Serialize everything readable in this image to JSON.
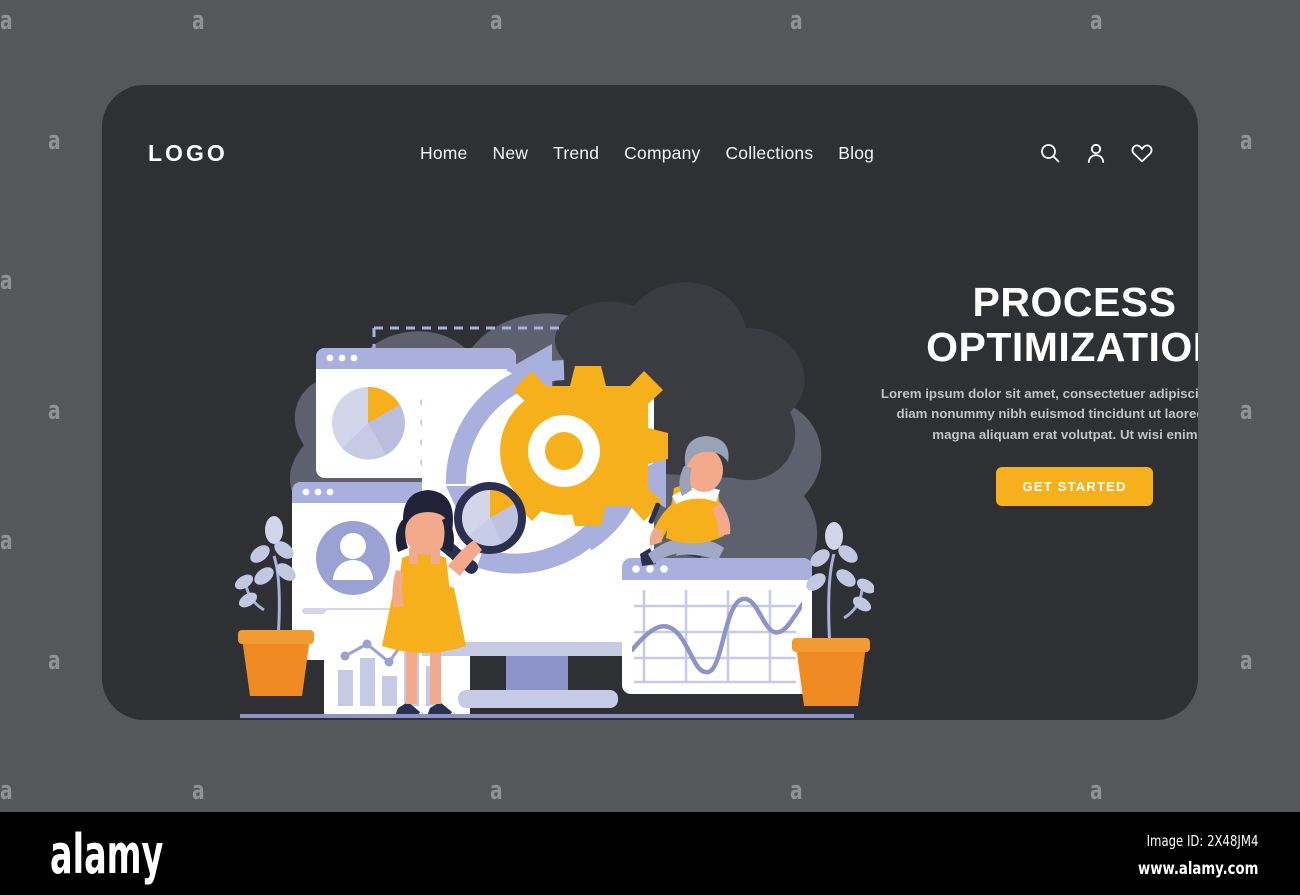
{
  "page": {
    "background_color": "#555759",
    "card_color": "#2f3033",
    "accent_color": "#F5B01C",
    "periwinkle": "#A9B0DE",
    "navy": "#2B3050"
  },
  "header": {
    "logo": "LOGO",
    "nav_items": [
      {
        "label": "Home"
      },
      {
        "label": "New"
      },
      {
        "label": "Trend"
      },
      {
        "label": "Company"
      },
      {
        "label": "Collections"
      },
      {
        "label": "Blog"
      }
    ],
    "icons": [
      {
        "name": "search-icon"
      },
      {
        "name": "user-icon"
      },
      {
        "name": "heart-icon"
      }
    ]
  },
  "hero": {
    "title_line1": "PROCESS",
    "title_line2": "OPTIMIZATION",
    "paragraph": "Lorem ipsum dolor sit amet, consectetuer adipiscing elit, sed diam nonummy nibh euismod tincidunt ut laoreet dolore magna aliquam erat volutpat. Ut wisi enim ad",
    "cta_label": "GET STARTED"
  },
  "illustration": {
    "name": "process-optimization-illustration",
    "elements": [
      "cloud-blob-background",
      "pie-chart-card",
      "user-avatar-card",
      "bar-chart-card",
      "monitor-with-gear",
      "circular-arrows",
      "magnifier-with-pie",
      "woman-with-magnifier",
      "man-seated-with-pen",
      "line-chart-card",
      "potted-plant-left",
      "potted-plant-right",
      "dashed-connectors"
    ]
  },
  "watermark": {
    "tile_letter": "a",
    "brand": "alamy"
  },
  "footer": {
    "logo": "alamy",
    "image_id": "Image ID: 2X48JM4",
    "url": "www.alamy.com"
  }
}
